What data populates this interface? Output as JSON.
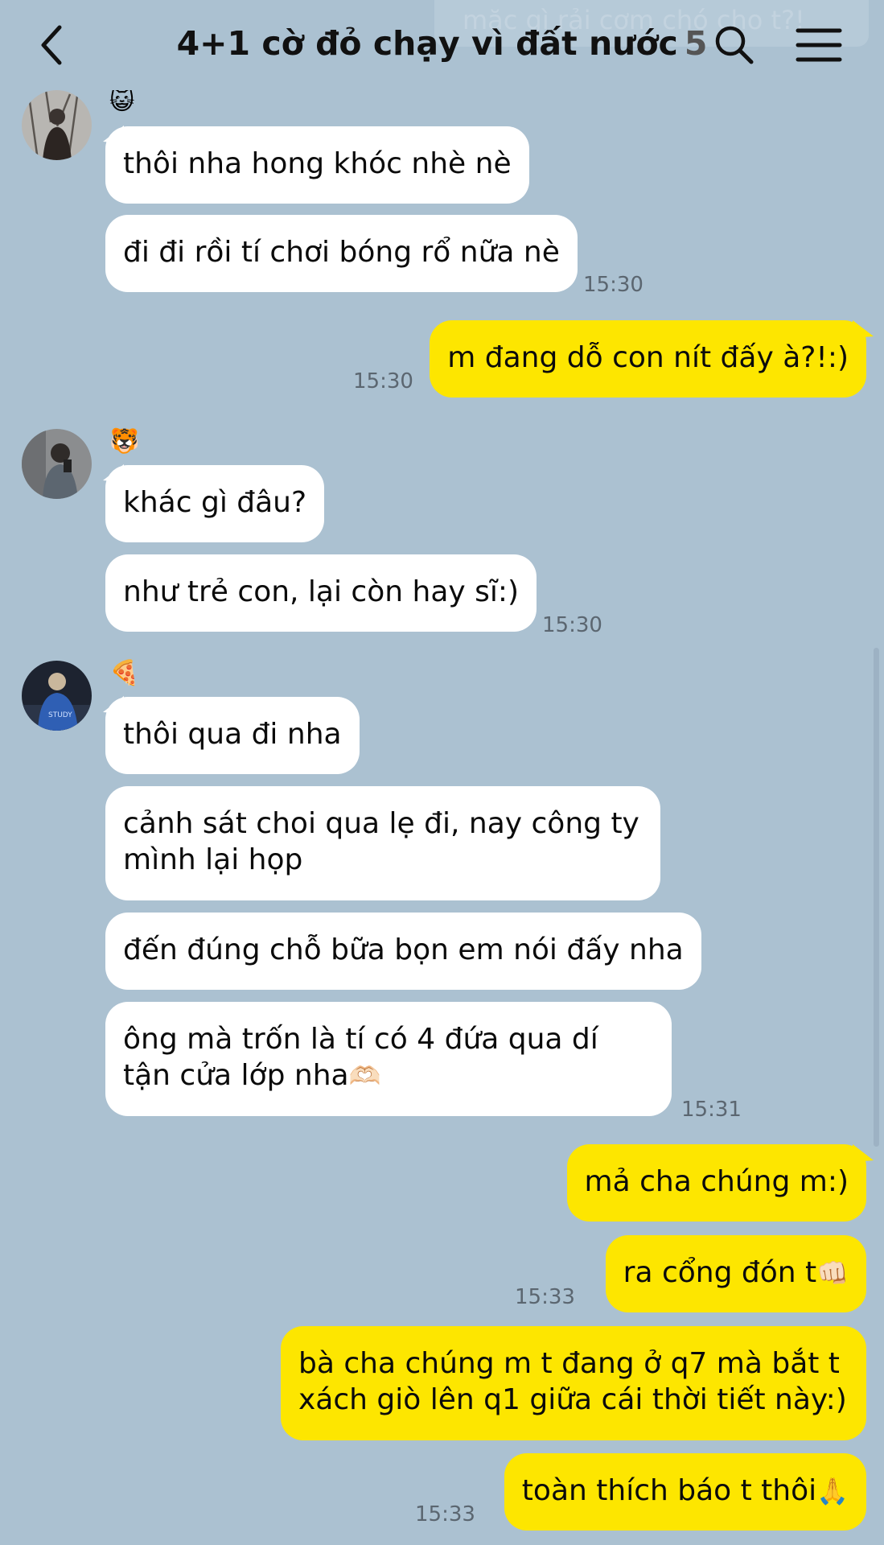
{
  "header": {
    "pinned_preview": "mặc gì rải cơm chó cho t?!",
    "title": "4+1 cờ đỏ chạy vì đất nước",
    "member_count": "5"
  },
  "messages": {
    "g1": {
      "emoji": "😺",
      "m1": "thôi nha hong khóc nhè nè",
      "m2": "đi đi rồi tí chơi bóng rổ nữa nè",
      "time": "15:30"
    },
    "o1": {
      "m1": "m đang dỗ con nít đấy à?!:)",
      "time": "15:30"
    },
    "g2": {
      "emoji": "🐯",
      "m1": "khác gì đâu?",
      "m2": "như trẻ con, lại còn hay sĩ:)",
      "time": "15:30"
    },
    "g3": {
      "emoji": "🍕",
      "m1": "thôi qua đi nha",
      "m2": "cảnh sát choi qua lẹ đi, nay công ty mình lại họp",
      "m3": "đến đúng chỗ bữa bọn em nói đấy nha",
      "m4": "ông mà trốn là tí có 4 đứa qua dí tận cửa lớp nha",
      "m4_emoji": "🫶🏻",
      "time": "15:31"
    },
    "o2": {
      "m1": "mả cha chúng m:)",
      "m2": "ra cổng đón t",
      "m2_emoji": "👊🏻",
      "m2_time": "15:33",
      "m3": "bà cha chúng m t đang ở q7 mà bắt t xách giò lên q1 giữa cái thời tiết này:)",
      "m4": "toàn thích báo t thôi",
      "m4_emoji": "🙏",
      "time": "15:33"
    }
  },
  "colors": {
    "background": "#abc1d1",
    "incoming_bubble": "#ffffff",
    "outgoing_bubble": "#fde600"
  }
}
